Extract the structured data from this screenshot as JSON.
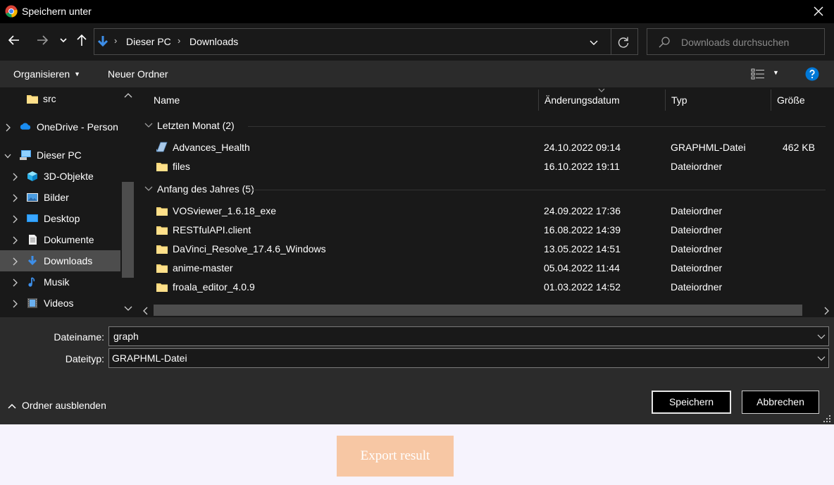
{
  "window": {
    "title": "Speichern unter"
  },
  "address": {
    "breadcrumbs": [
      "Dieser PC",
      "Downloads"
    ]
  },
  "search": {
    "placeholder": "Downloads durchsuchen"
  },
  "commandbar": {
    "organize_label": "Organisieren",
    "new_folder_label": "Neuer Ordner"
  },
  "tree": {
    "items": [
      {
        "label": "src",
        "icon": "folder-icon",
        "expandable": false,
        "selected": false
      },
      {
        "label": "OneDrive - Person",
        "icon": "onedrive-cloud-icon",
        "expandable": true,
        "selected": false
      },
      {
        "label": "Dieser PC",
        "icon": "this-pc-icon",
        "expandable": true,
        "expanded": true,
        "selected": false
      },
      {
        "label": "3D-Objekte",
        "icon": "3d-objects-icon",
        "expandable": true,
        "selected": false
      },
      {
        "label": "Bilder",
        "icon": "pictures-icon",
        "expandable": true,
        "selected": false
      },
      {
        "label": "Desktop",
        "icon": "desktop-icon",
        "expandable": true,
        "selected": false
      },
      {
        "label": "Dokumente",
        "icon": "documents-icon",
        "expandable": true,
        "selected": false
      },
      {
        "label": "Downloads",
        "icon": "downloads-icon",
        "expandable": true,
        "selected": true
      },
      {
        "label": "Musik",
        "icon": "music-icon",
        "expandable": true,
        "selected": false
      },
      {
        "label": "Videos",
        "icon": "videos-icon",
        "expandable": true,
        "selected": false
      }
    ]
  },
  "columns": {
    "name": "Name",
    "date": "Änderungsdatum",
    "type": "Typ",
    "size": "Größe"
  },
  "groups": [
    {
      "label": "Letzten Monat (2)",
      "files": [
        {
          "name": "Advances_Health",
          "date": "24.10.2022 09:14",
          "type": "GRAPHML-Datei",
          "size": "462 KB",
          "icon": "graphml-file-icon"
        },
        {
          "name": "files",
          "date": "16.10.2022 19:11",
          "type": "Dateiordner",
          "size": "",
          "icon": "folder-icon"
        }
      ]
    },
    {
      "label": "Anfang des Jahres (5)",
      "files": [
        {
          "name": "VOSviewer_1.6.18_exe",
          "date": "24.09.2022 17:36",
          "type": "Dateiordner",
          "size": "",
          "icon": "folder-icon"
        },
        {
          "name": "RESTfulAPI.client",
          "date": "16.08.2022 14:39",
          "type": "Dateiordner",
          "size": "",
          "icon": "folder-icon"
        },
        {
          "name": "DaVinci_Resolve_17.4.6_Windows",
          "date": "13.05.2022 14:51",
          "type": "Dateiordner",
          "size": "",
          "icon": "folder-icon"
        },
        {
          "name": "anime-master",
          "date": "05.04.2022 11:44",
          "type": "Dateiordner",
          "size": "",
          "icon": "folder-icon"
        },
        {
          "name": "froala_editor_4.0.9",
          "date": "01.03.2022 14:52",
          "type": "Dateiordner",
          "size": "",
          "icon": "folder-icon"
        }
      ]
    }
  ],
  "form": {
    "filename_label": "Dateiname:",
    "filename_value": "graph",
    "filetype_label": "Dateityp:",
    "filetype_value": "GRAPHML-Datei"
  },
  "footer": {
    "hide_folders_label": "Ordner ausblenden",
    "save_label": "Speichern",
    "cancel_label": "Abbrechen"
  },
  "page": {
    "export_label": "Export result"
  },
  "colors": {
    "dialog_bg": "#191919",
    "toolbar_bg": "#2b2b2b",
    "titlebar_bg": "#000000",
    "folder_yellow": "#f8d775",
    "accent_blue": "#0078d7",
    "export_button": "#f7c7a4",
    "page_bg": "#f6f3fd"
  }
}
